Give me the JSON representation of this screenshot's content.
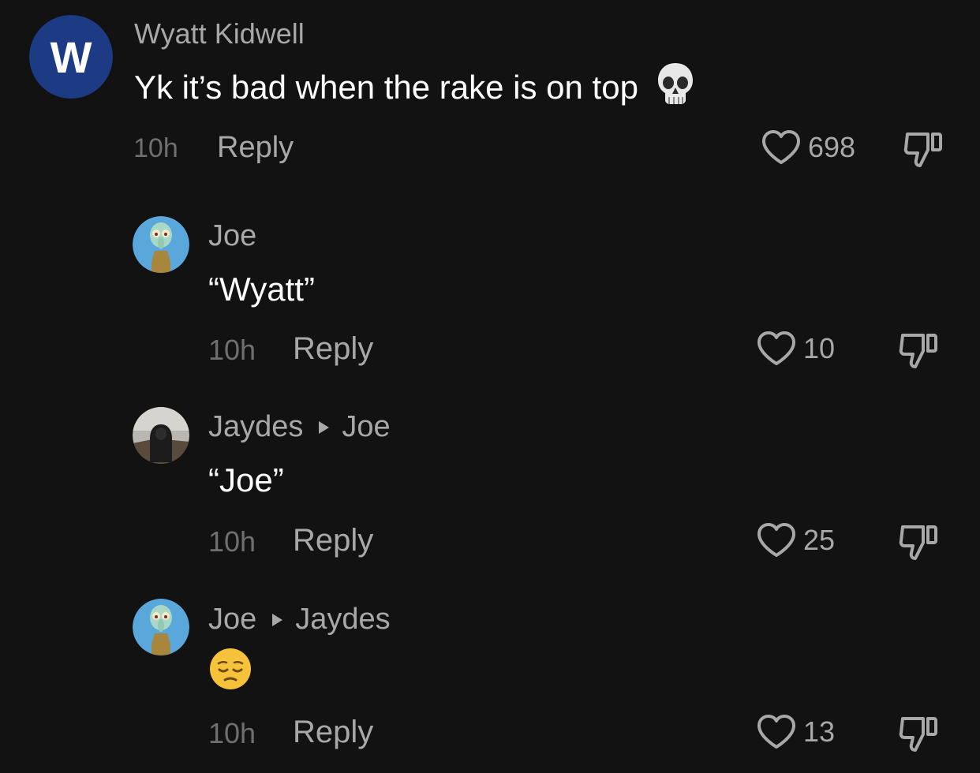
{
  "colors": {
    "background": "#121212",
    "primary_text": "#ffffff",
    "secondary_text": "#a8a8a8",
    "timestamp": "#6f6f6f",
    "avatar_w_bg": "#1d3b85"
  },
  "comments": [
    {
      "username": "Wyatt Kidwell",
      "avatar_letter": "W",
      "avatar_icon": "letter-w-avatar",
      "text": "Yk it’s bad when the rake is on top",
      "emoji": "skull-emoji",
      "time": "10h",
      "reply_label": "Reply",
      "likes": "698",
      "liked": false
    },
    {
      "username": "Joe",
      "avatar_icon": "squidward-avatar",
      "text": "“Wyatt”",
      "time": "10h",
      "reply_label": "Reply",
      "likes": "10",
      "liked": false
    },
    {
      "username": "Jaydes",
      "reply_to": "Joe",
      "avatar_icon": "hooded-figure-avatar",
      "text": "“Joe”",
      "time": "10h",
      "reply_label": "Reply",
      "likes": "25",
      "liked": false
    },
    {
      "username": "Joe",
      "reply_to": "Jaydes",
      "avatar_icon": "squidward-avatar",
      "text": "",
      "emoji": "pensive-face-emoji",
      "time": "10h",
      "reply_label": "Reply",
      "likes": "13",
      "liked": false
    }
  ]
}
